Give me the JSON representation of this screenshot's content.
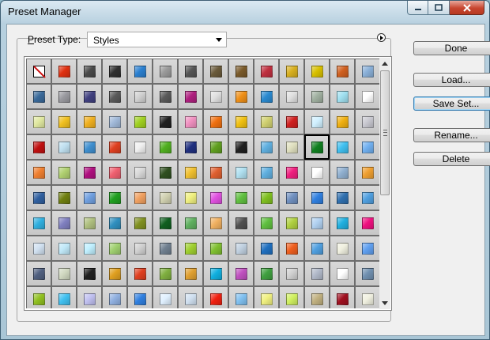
{
  "window": {
    "title": "Preset Manager"
  },
  "preset": {
    "label": "Preset Type:",
    "label_mnemonic": "P",
    "label_rest": "reset Type:",
    "selected": "Styles"
  },
  "buttons": {
    "done": "Done",
    "load": "Load...",
    "save_set": "Save Set...",
    "rename": "Rename...",
    "delete": "Delete"
  },
  "styles_grid": {
    "columns": 14,
    "swatches": [
      "none",
      "#e03010",
      "#4a4a4a",
      "#303030",
      "#2a7fd0",
      "#9a9a9a",
      "#555555",
      "#6a5a3a",
      "#7a5a2a",
      "#c03040",
      "#d8b020",
      "#d8c000",
      "#d06020",
      "#8ab0d8",
      "#3a6a9a",
      "#9a9aa0",
      "#404080",
      "#5a5a5a",
      "#d0d0d0",
      "#5a5a5a",
      "#b02080",
      "#e0e0e0",
      "#f09018",
      "#2a8ad0",
      "#e0e0e0",
      "#a0b0a0",
      "#a0e0f0",
      "#ffffff",
      "#e0e8a0",
      "#f0c020",
      "#f0b020",
      "#a0b8d8",
      "#a0d020",
      "#202020",
      "#f090c0",
      "#f07010",
      "#f0c010",
      "#d0d070",
      "#d02020",
      "#d0f0ff",
      "#f0b010",
      "#c8c8d0",
      "#c01010",
      "#c0e0f0",
      "#4090d0",
      "#e04020",
      "#f0f0f0",
      "#50b020",
      "#203080",
      "#60a020",
      "#202020",
      "#60b0e0",
      "#e0e0c0",
      "#108020",
      "#40c0f0",
      "#70b0f0",
      "#f08030",
      "#b0d070",
      "#b01080",
      "#f06070",
      "#d8d8d8",
      "#305020",
      "#f0c030",
      "#e06030",
      "#b0e0f0",
      "#60b0e0",
      "#f02080",
      "#ffffff",
      "#90b0d0",
      "#f0a030",
      "#3060a0",
      "#708010",
      "#70a0e0",
      "#20a020",
      "#f0a060",
      "#d0d0b0",
      "#f0f080",
      "#e050e0",
      "#60c040",
      "#80c020",
      "#7090c0",
      "#3080e0",
      "#3070b0",
      "#50a0e0",
      "#30b0e0",
      "#8080c0",
      "#b0c080",
      "#3090c0",
      "#809020",
      "#106020",
      "#60b060",
      "#f0b060",
      "#505050",
      "#60c040",
      "#b0d040",
      "#b0d0f0",
      "#20b0e0",
      "#f01080",
      "#d0e0f0",
      "#c0e8f8",
      "#c0f0ff",
      "#a0d070",
      "#d0d0d0",
      "#708090",
      "#a0d030",
      "#80c030",
      "#c0d0e0",
      "#2070c0",
      "#f06020",
      "#50a0e0",
      "#f0f0e0",
      "#60a0f0",
      "#506080",
      "#d0d8c0",
      "#202020",
      "#e0a020",
      "#e04020",
      "#80b040",
      "#e0a030",
      "#10b0e0",
      "#c050c0",
      "#40a040",
      "#d0d0d0",
      "#b0b8c8",
      "#ffffff",
      "#7090b0",
      "#90c020",
      "#40c0f0",
      "#c0c0f0",
      "#90b0e0",
      "#3080e0",
      "#e0f0ff",
      "#d0e0f0",
      "#f02010",
      "#80c0f0",
      "#f0f080",
      "#d0f060",
      "#c0b080",
      "#a01020",
      "#f0f0e0"
    ]
  },
  "icons": {
    "flyout": "circle-arrow-right-icon",
    "minimize": "minimize-icon",
    "maximize": "maximize-icon",
    "close": "close-icon",
    "select_arrow": "chevron-down-icon",
    "scroll_up": "arrow-up-icon",
    "scroll_down": "arrow-down-icon"
  },
  "scroll": {
    "position": 0.0,
    "visible_fraction": 0.5
  }
}
